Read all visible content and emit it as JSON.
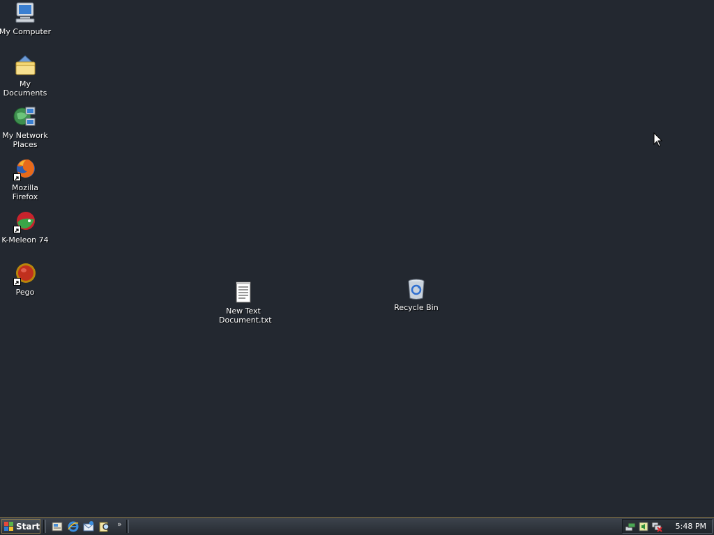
{
  "desktop": {
    "icons": [
      {
        "label": "My Computer",
        "icon": "my-computer-icon"
      },
      {
        "label": "My Documents",
        "icon": "my-documents-icon"
      },
      {
        "label": "My Network Places",
        "icon": "network-places-icon"
      },
      {
        "label": "Mozilla Firefox",
        "icon": "firefox-icon"
      },
      {
        "label": "K-Meleon 74",
        "icon": "kmeleon-icon"
      },
      {
        "label": "Pego",
        "icon": "pego-icon"
      },
      {
        "label": "New Text Document.txt",
        "icon": "text-document-icon"
      },
      {
        "label": "Recycle Bin",
        "icon": "recycle-bin-icon"
      }
    ]
  },
  "taskbar": {
    "start_label": "Start",
    "quick_launch": [
      "show-desktop-icon",
      "internet-explorer-icon",
      "outlook-express-icon",
      "search-icon"
    ],
    "overflow": "»",
    "tray_icons": [
      "network-icon",
      "speaker-icon",
      "network-disconnected-icon"
    ],
    "clock": "5:48 PM"
  },
  "colors": {
    "desktop_background": "#232830",
    "taskbar_border": "#7d6a3a"
  }
}
